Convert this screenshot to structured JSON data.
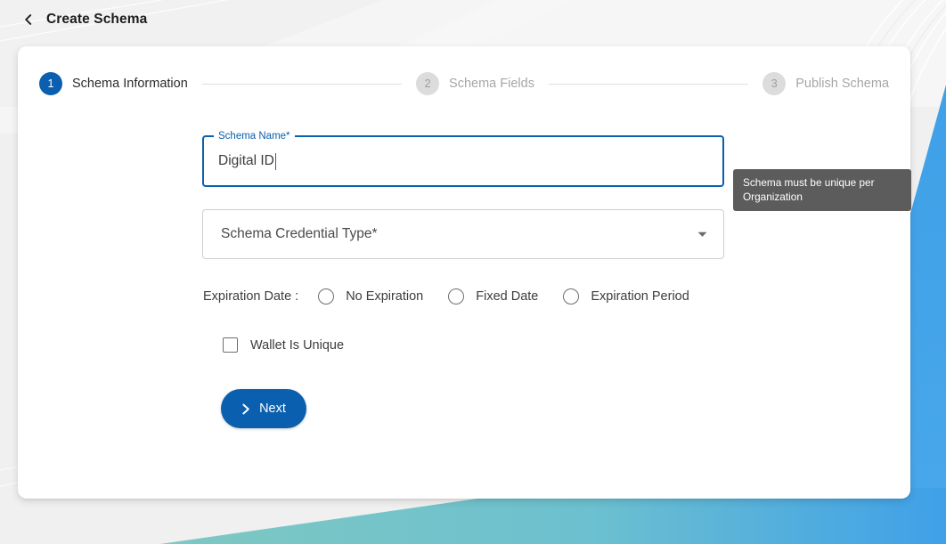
{
  "header": {
    "back_icon": "chevron-left-icon",
    "title": "Create Schema"
  },
  "stepper": {
    "steps": [
      {
        "number": "1",
        "label": "Schema Information",
        "state": "active"
      },
      {
        "number": "2",
        "label": "Schema Fields",
        "state": "inactive"
      },
      {
        "number": "3",
        "label": "Publish Schema",
        "state": "inactive"
      }
    ]
  },
  "form": {
    "schema_name": {
      "label": "Schema Name*",
      "value": "Digital ID",
      "focused": true
    },
    "credential_type": {
      "placeholder": "Schema Credential Type*",
      "value": "",
      "arrow_icon": "chevron-down-icon",
      "options": []
    },
    "expiration": {
      "label": "Expiration Date :",
      "options": [
        {
          "label": "No Expiration",
          "selected": false
        },
        {
          "label": "Fixed Date",
          "selected": false
        },
        {
          "label": "Expiration Period",
          "selected": false
        }
      ]
    },
    "wallet_unique": {
      "label": "Wallet Is Unique",
      "checked": false
    },
    "next_button": {
      "label": "Next",
      "icon": "chevron-right-icon"
    }
  },
  "tooltip": {
    "text": "Schema must be unique per Organization"
  },
  "colors": {
    "primary_blue": "#0a5fae",
    "accent_blue": "#3fa0e8",
    "accent_teal": "#79c7c2",
    "tooltip_bg": "#5c5c5c",
    "page_bg": "#f0f0f0"
  }
}
